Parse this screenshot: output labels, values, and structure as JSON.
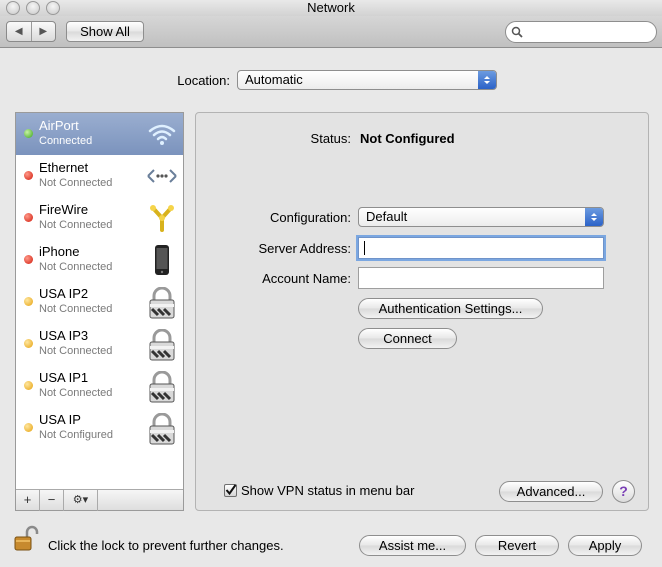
{
  "window": {
    "title": "Network"
  },
  "toolbar": {
    "back_glyph": "◀",
    "forward_glyph": "▶",
    "show_all_label": "Show All",
    "search_placeholder": ""
  },
  "location": {
    "label": "Location:",
    "value": "Automatic"
  },
  "services": [
    {
      "name": "AirPort",
      "status": "Connected",
      "dot": "green",
      "icon": "wifi-icon",
      "selected": true
    },
    {
      "name": "Ethernet",
      "status": "Not Connected",
      "dot": "red",
      "icon": "ethernet-icon"
    },
    {
      "name": "FireWire",
      "status": "Not Connected",
      "dot": "red",
      "icon": "firewire-icon"
    },
    {
      "name": "iPhone",
      "status": "Not Connected",
      "dot": "red",
      "icon": "iphone-icon"
    },
    {
      "name": "USA IP2",
      "status": "Not Connected",
      "dot": "yellow",
      "icon": "vpn-lock-icon"
    },
    {
      "name": "USA IP3",
      "status": "Not Connected",
      "dot": "yellow",
      "icon": "vpn-lock-icon"
    },
    {
      "name": "USA IP1",
      "status": "Not Connected",
      "dot": "yellow",
      "icon": "vpn-lock-icon"
    },
    {
      "name": "USA IP",
      "status": "Not Configured",
      "dot": "yellow",
      "icon": "vpn-lock-icon"
    }
  ],
  "sidebar_buttons": {
    "add": "+",
    "remove": "−",
    "action": "⚙▾"
  },
  "detail": {
    "status_label": "Status:",
    "status_value": "Not Configured",
    "configuration_label": "Configuration:",
    "configuration_value": "Default",
    "server_address_label": "Server Address:",
    "server_address_value": "",
    "account_name_label": "Account Name:",
    "account_name_value": "",
    "auth_button": "Authentication Settings...",
    "connect_button": "Connect",
    "show_vpn_label": "Show VPN status in menu bar",
    "show_vpn_checked": true,
    "advanced_button": "Advanced...",
    "help_glyph": "?"
  },
  "footer": {
    "lock_text": "Click the lock to prevent further changes.",
    "assist_button": "Assist me...",
    "revert_button": "Revert",
    "apply_button": "Apply"
  },
  "colors": {
    "selection": "#8aa1c8",
    "accent": "#2b62c8",
    "status_green": "#3aa51c",
    "status_red": "#d11a0b",
    "status_yellow": "#e6a10d"
  }
}
